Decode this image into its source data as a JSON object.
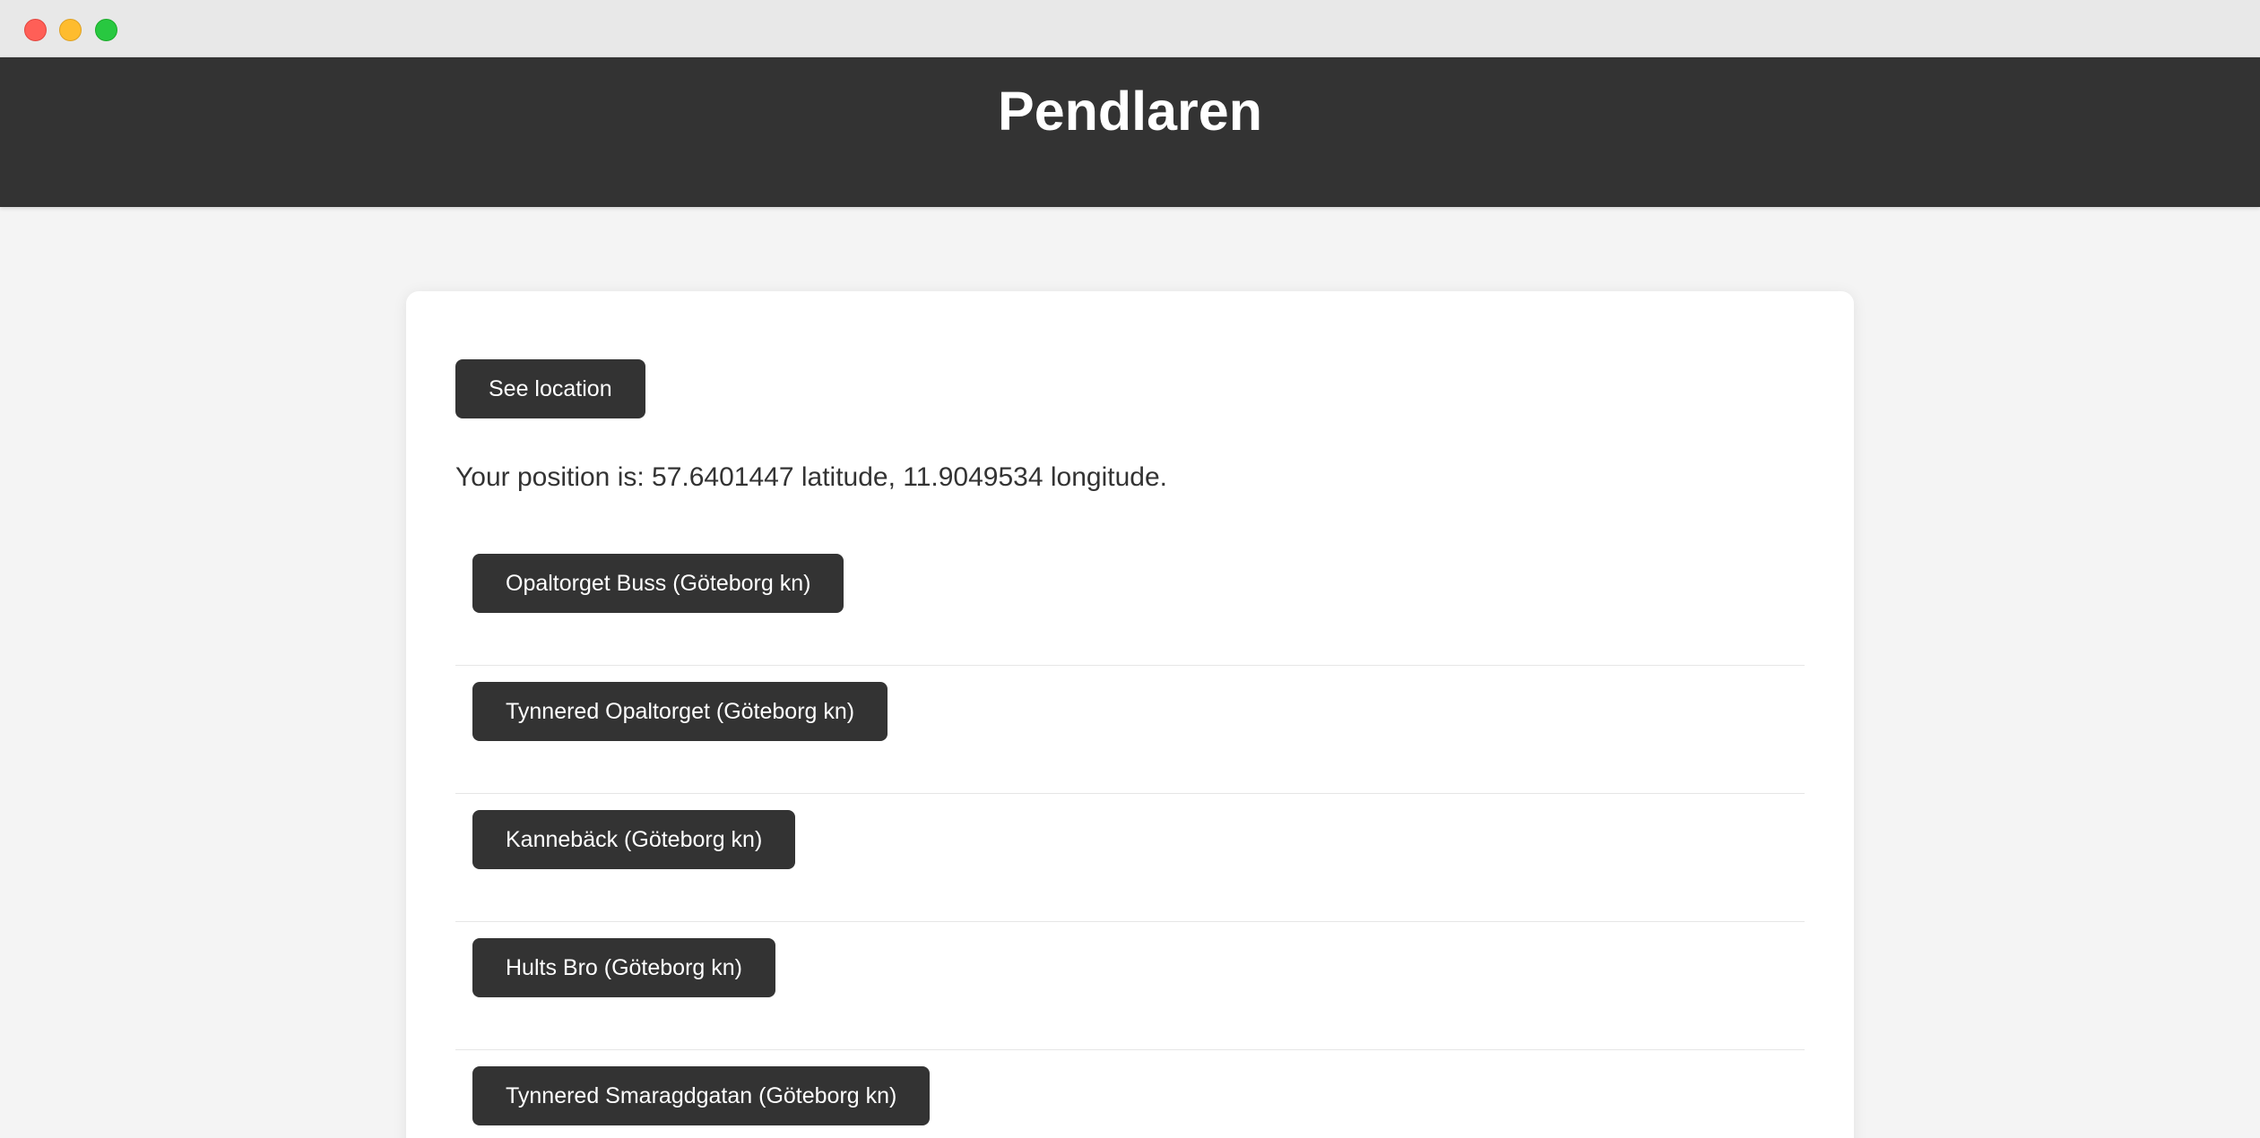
{
  "window": {
    "controls": [
      "close",
      "minimize",
      "maximize"
    ]
  },
  "header": {
    "title": "Pendlaren"
  },
  "main": {
    "see_location_label": "See location",
    "position_text": "Your position is: 57.6401447 latitude, 11.9049534 longitude.",
    "stops": [
      {
        "label": "Opaltorget Buss (Göteborg kn)"
      },
      {
        "label": "Tynnered Opaltorget (Göteborg kn)"
      },
      {
        "label": "Kannebäck (Göteborg kn)"
      },
      {
        "label": "Hults Bro (Göteborg kn)"
      },
      {
        "label": "Tynnered Smaragdgatan (Göteborg kn)"
      }
    ]
  },
  "colors": {
    "header_bg": "#333333",
    "button_bg": "#333333",
    "page_bg": "#f4f4f4",
    "card_bg": "#ffffff"
  }
}
